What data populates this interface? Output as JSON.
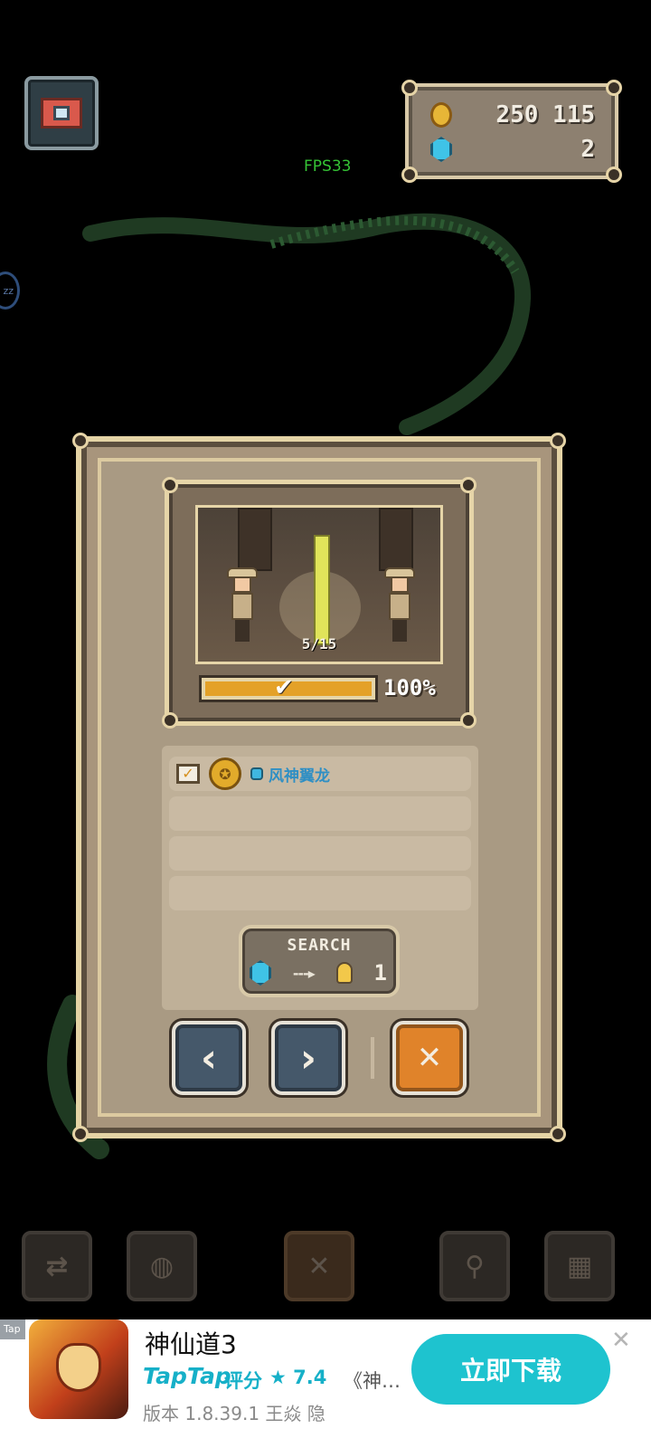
{
  "hud": {
    "fps": "FPS33",
    "coins": "250 115",
    "gems": "2",
    "side_bubble": "zz",
    "icons": [
      "camera-icon",
      "coin-icon",
      "gem-icon"
    ]
  },
  "dialog": {
    "scene_counter": "5/15",
    "progress_label": "100%",
    "progress_value": 1.0,
    "list_items": [
      {
        "label": "风神翼龙",
        "checked": true
      },
      {
        "label": ""
      },
      {
        "label": ""
      },
      {
        "label": ""
      }
    ],
    "search": {
      "label": "SEARCH",
      "arrow": "---▸",
      "cost": "1"
    },
    "buttons": {
      "prev": "‹",
      "next": "›",
      "close": "✕"
    }
  },
  "toolbar": {
    "icons": [
      "swap-icon",
      "lightbulb-icon",
      "close-icon",
      "magnifier-icon",
      "map-icon"
    ],
    "close_glyph": "✕"
  },
  "ad": {
    "tag": "Tap",
    "title": "神仙道3",
    "brand": "TapTap",
    "rating_label": "评分",
    "rating": "★ 7.4",
    "desc": "《神…",
    "version": "版本 1.8.39.1 王焱 隐",
    "cta": "立即下载",
    "close": "✕"
  },
  "colors": {
    "panel_border": "#e4d3a5",
    "progress_fill": "#e4a128",
    "item_text": "#2f8fc4",
    "close_button": "#e0832a",
    "nav_button": "#45586a",
    "cta": "#1ec3cf"
  }
}
